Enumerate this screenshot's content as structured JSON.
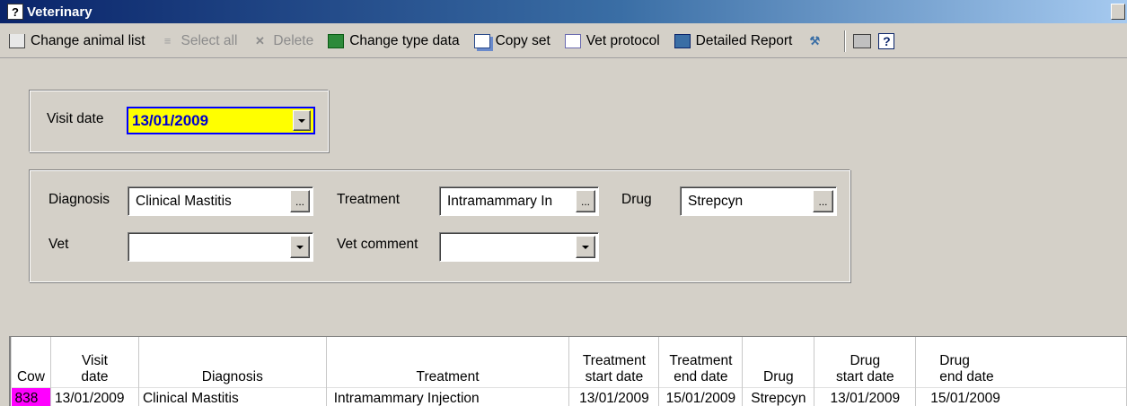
{
  "window": {
    "title": "Veterinary",
    "app_icon": "?"
  },
  "toolbar": {
    "items": [
      {
        "label": "Change animal list",
        "icon": "cart-icon",
        "enabled": true
      },
      {
        "label": "Select all",
        "icon": "list-icon",
        "enabled": false
      },
      {
        "label": "Delete",
        "icon": "delete-icon",
        "enabled": false
      },
      {
        "label": "Change type data",
        "icon": "type-data-icon",
        "enabled": true
      },
      {
        "label": "Copy set",
        "icon": "copy-icon",
        "enabled": true
      },
      {
        "label": "Vet protocol",
        "icon": "vet-protocol-icon",
        "enabled": true
      },
      {
        "label": "Detailed Report",
        "icon": "report-icon",
        "enabled": true
      }
    ],
    "help_glyph": "?"
  },
  "visit": {
    "label": "Visit date",
    "value": "13/01/2009"
  },
  "form": {
    "diagnosis_label": "Diagnosis",
    "diagnosis_value": "Clinical Mastitis",
    "treatment_label": "Treatment",
    "treatment_value": "Intramammary In",
    "drug_label": "Drug",
    "drug_value": "Strepcyn",
    "vet_label": "Vet",
    "vet_value": "",
    "vet_comment_label": "Vet comment",
    "vet_comment_value": "",
    "ellipsis": "..."
  },
  "table": {
    "headers": {
      "cow": "Cow",
      "visit_1": "Visit",
      "visit_2": "date",
      "diagnosis": "Diagnosis",
      "treatment": "Treatment",
      "tstart_1": "Treatment",
      "tstart_2": "start date",
      "tend_1": "Treatment",
      "tend_2": "end date",
      "drug": "Drug",
      "dstart_1": "Drug",
      "dstart_2": "start date",
      "dend_1": "Drug",
      "dend_2": "end date"
    },
    "rows": [
      {
        "cow": "838",
        "visit_date": "13/01/2009",
        "diagnosis": "Clinical Mastitis",
        "treatment": "Intramammary Injection",
        "treatment_start": "13/01/2009",
        "treatment_end": "15/01/2009",
        "drug": "Strepcyn",
        "drug_start": "13/01/2009",
        "drug_end": "15/01/2009"
      }
    ],
    "highlight_color": "#ff00ff"
  }
}
